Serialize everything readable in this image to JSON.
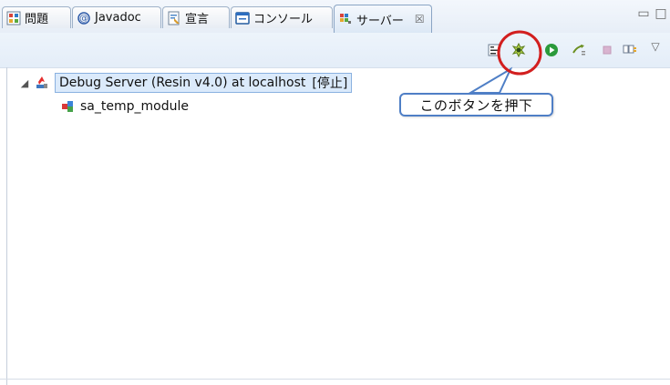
{
  "tabs": [
    {
      "label": "問題",
      "icon": "problems-icon"
    },
    {
      "label": "Javadoc",
      "icon": "javadoc-icon"
    },
    {
      "label": "宣言",
      "icon": "declaration-icon"
    },
    {
      "label": "コンソール",
      "icon": "console-icon"
    },
    {
      "label": "サーバー",
      "icon": "servers-icon",
      "active": true,
      "close": "☒"
    }
  ],
  "window_controls": {
    "minimize": "▭",
    "maximize": "□"
  },
  "toolbar": {
    "buttons": [
      {
        "name": "collapse-all-icon"
      },
      {
        "name": "debug-server-icon"
      },
      {
        "name": "start-server-icon"
      },
      {
        "name": "publish-icon"
      },
      {
        "name": "stop-server-icon"
      },
      {
        "name": "disconnect-icon"
      }
    ],
    "menu": "▽"
  },
  "tree": {
    "server": {
      "expander": "◢",
      "label": "Debug Server (Resin v4.0) at localhost",
      "status": "[停止]",
      "icon": "server-icon"
    },
    "module": {
      "label": "sa_temp_module",
      "icon": "module-icon"
    }
  },
  "annotation": {
    "text": "このボタンを押下",
    "target": "debug-server-icon",
    "highlight_color": "#d21f1f",
    "callout_color": "#4f7fc6"
  }
}
